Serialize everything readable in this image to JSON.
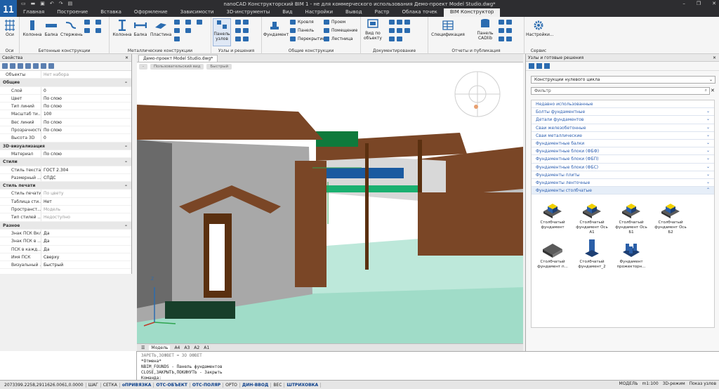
{
  "window": {
    "title": "nanoCAD Конструкторский BIM 1 - не для коммерческого использования Демо-проект Model Studio.dwg*",
    "logo": "11"
  },
  "menu_tabs": [
    "Главная",
    "Построение",
    "Вставка",
    "Оформление",
    "Зависимости",
    "3D-инструменты",
    "Вид",
    "Настройки",
    "Вывод",
    "Растр",
    "Облака точек",
    "BIM Конструктор"
  ],
  "ribbon": {
    "groups": {
      "axes": "Оси",
      "concrete": "Бетонные конструкции",
      "metal": "Металлические конструкции",
      "nodes": "Узлы и решения",
      "general": "Общие конструкции",
      "docs": "Документирование",
      "reports": "Отчеты и публикация",
      "service": "Сервис"
    },
    "buttons": {
      "axes": "Оси",
      "c_column": "Колонна",
      "c_beam": "Балка",
      "c_rod": "Стержень",
      "m_column": "Колонна",
      "m_beam": "Балка",
      "m_plate": "Пластина",
      "nodes_panel": "Панель узлов",
      "foundation": "Фундамент",
      "roof": "Кровля",
      "panel": "Панель",
      "slab": "Перекрытие",
      "opening": "Проем",
      "room": "Помещение",
      "stair": "Лестница",
      "view_by_object": "Вид по объекту",
      "spec": "Спецификация",
      "cadlib": "Панель CADlib",
      "settings": "Настройки..."
    }
  },
  "properties": {
    "title": "Свойства",
    "object_label": "Объекты",
    "object_value": "Нет набора",
    "sections": [
      {
        "name": "Общие",
        "rows": [
          {
            "k": "Слой",
            "v": "0"
          },
          {
            "k": "Цвет",
            "v": "По слою"
          },
          {
            "k": "Тип линий",
            "v": "По слою"
          },
          {
            "k": "Масштаб ти...",
            "v": "100"
          },
          {
            "k": "Вес линий",
            "v": "По слою"
          },
          {
            "k": "Прозрачность",
            "v": "По слою"
          },
          {
            "k": "Высота 3D",
            "v": "0"
          }
        ]
      },
      {
        "name": "3D-визуализация",
        "rows": [
          {
            "k": "Материал",
            "v": "По слою"
          }
        ]
      },
      {
        "name": "Стили",
        "rows": [
          {
            "k": "Стиль текста",
            "v": "ГОСТ 2.304"
          },
          {
            "k": "Размерный ...",
            "v": "СПДС"
          }
        ]
      },
      {
        "name": "Стиль печати",
        "rows": [
          {
            "k": "Стиль печати",
            "v": "По цвету",
            "gray": true
          },
          {
            "k": "Таблица сти...",
            "v": "Нет"
          },
          {
            "k": "Пространст...",
            "v": "Модель",
            "gray": true
          },
          {
            "k": "Тип стилей ...",
            "v": "Недоступно",
            "gray": true
          }
        ]
      },
      {
        "name": "Разное",
        "rows": [
          {
            "k": "Знак ПСК Вкл",
            "v": "Да"
          },
          {
            "k": "Знак ПСК в ...",
            "v": "Да"
          },
          {
            "k": "ПСК в кажд...",
            "v": "Да"
          },
          {
            "k": "Имя ПСК",
            "v": "Сверху"
          },
          {
            "k": "Визуальный ...",
            "v": "Быстрый"
          }
        ]
      }
    ]
  },
  "document": {
    "tab": "Демо-проект Model Studio.dwg*",
    "view_chips": [
      "-",
      "Пользовательский вид",
      "Быстрый"
    ],
    "layout_tabs": [
      "Модель",
      "A4",
      "A3",
      "A2",
      "A1"
    ],
    "axis_label": "Z"
  },
  "library": {
    "title": "Узлы и готовые решения",
    "combo": "Конструкции нулевого цикла",
    "filter_placeholder": "Фильтр",
    "categories": [
      "Недавно использованные",
      "Болты фундаментные",
      "Детали фундаментов",
      "Сваи железобетонные",
      "Сваи металлические",
      "Фундаментные балки",
      "Фундаментные блоки (ФБФ)",
      "Фундаментные блоки (ФБП)",
      "Фундаментные блоки (ФБС)",
      "Фундаменты плиты",
      "Фундаменты ленточные",
      "Фундаменты столбчатые"
    ],
    "items": [
      {
        "l1": "Столбчатый",
        "l2": "фундамент"
      },
      {
        "l1": "Столбчатый",
        "l2": "фундамент Ось А1"
      },
      {
        "l1": "Столбчатый",
        "l2": "фундамент Ось Б1"
      },
      {
        "l1": "Столбчатый",
        "l2": "фундамент Ось Б2"
      },
      {
        "l1": "Столбчатый",
        "l2": "фундамент п..."
      },
      {
        "l1": "Столбчатый",
        "l2": "фундамент_2"
      },
      {
        "l1": "Фундамент",
        "l2": "прожекторн..."
      }
    ]
  },
  "command_line": {
    "lines": [
      "ЗАРЕТЬ,ЗОФВЕТ = ЗО ОФВЕТ",
      "*Отмена*",
      "NBIM_FOUNDS - Панель фундаментов",
      "CLOSE,ЗАКРЫТЬ,ПОКИНУТЬ - Закрыть",
      "Команда:"
    ]
  },
  "status": {
    "coords": "2073399.2258,2911626.0061,0.0000",
    "toggles": [
      {
        "label": "ШАГ",
        "on": false
      },
      {
        "label": "СЕТКА",
        "on": false
      },
      {
        "label": "оПРИВЯЗКА",
        "on": true
      },
      {
        "label": "ОТС-ОБЪЕКТ",
        "on": true
      },
      {
        "label": "ОТС-ПОЛЯР",
        "on": true
      },
      {
        "label": "ОРТО",
        "on": false
      },
      {
        "label": "ДИН-ВВОД",
        "on": true
      },
      {
        "label": "ВЕС",
        "on": false
      },
      {
        "label": "ШТРИХОВКА",
        "on": true
      }
    ],
    "model": "МОДЕЛЬ",
    "scale": "m1:100",
    "mode3d": "3D-режим",
    "show_nodes": "Показ узлов"
  }
}
